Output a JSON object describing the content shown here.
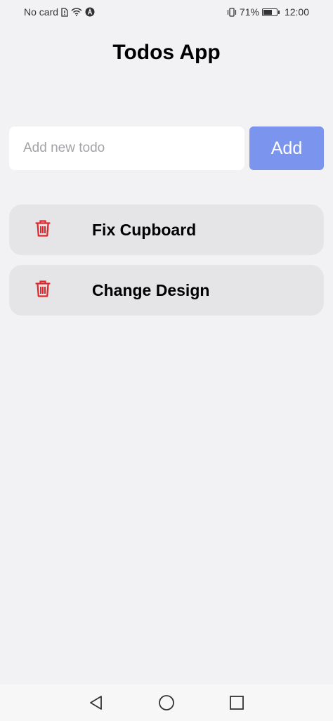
{
  "status_bar": {
    "carrier": "No card",
    "battery_percent": "71%",
    "battery_level": 0.71,
    "time": "12:00"
  },
  "app": {
    "title": "Todos App"
  },
  "input": {
    "placeholder": "Add new todo",
    "value": ""
  },
  "add_button": {
    "label": "Add"
  },
  "todos": [
    {
      "text": "Fix Cupboard"
    },
    {
      "text": "Change Design"
    }
  ],
  "colors": {
    "accent": "#7b95ee",
    "delete": "#e0262b",
    "background": "#f2f2f4",
    "item_background": "#e5e5e7"
  },
  "icons": {
    "delete": "trash-icon",
    "nav_back": "back-triangle-icon",
    "nav_home": "home-circle-icon",
    "nav_recent": "recent-square-icon"
  }
}
